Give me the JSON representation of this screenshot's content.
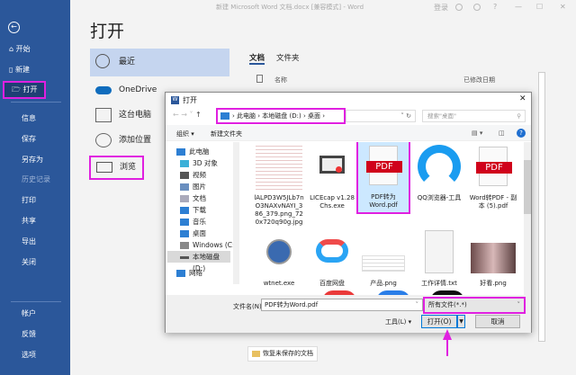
{
  "window": {
    "title": "新建 Microsoft Word 文档.docx [兼容模式] - Word",
    "login": "登录",
    "help": "?",
    "minimize": "—",
    "maximize": "☐",
    "close": "✕"
  },
  "sidebar": {
    "items": [
      {
        "label": "开始"
      },
      {
        "label": "新建"
      },
      {
        "label": "打开"
      },
      {
        "label": "信息"
      },
      {
        "label": "保存"
      },
      {
        "label": "另存为"
      },
      {
        "label": "历史记录"
      },
      {
        "label": "打印"
      },
      {
        "label": "共享"
      },
      {
        "label": "导出"
      },
      {
        "label": "关闭"
      },
      {
        "label": "帐户"
      },
      {
        "label": "反馈"
      },
      {
        "label": "选项"
      }
    ]
  },
  "main": {
    "title": "打开",
    "locations": [
      {
        "label": "最近"
      },
      {
        "label": "OneDrive"
      },
      {
        "label": "这台电脑"
      },
      {
        "label": "添加位置"
      },
      {
        "label": "浏览"
      }
    ],
    "tabs": [
      {
        "label": "文档"
      },
      {
        "label": "文件夹"
      }
    ],
    "columns": {
      "name": "名称",
      "modified": "已修改日期"
    },
    "recover": "恢复未保存的文档"
  },
  "dialog": {
    "title": "打开",
    "breadcrumb": [
      "此电脑",
      "本地磁盘 (D:)",
      "桌面"
    ],
    "search_placeholder": "搜索\"桌面\"",
    "organize": "组织 ▾",
    "new_folder": "新建文件夹",
    "nav": [
      {
        "label": "此电脑"
      },
      {
        "label": "3D 对象"
      },
      {
        "label": "视频"
      },
      {
        "label": "图片"
      },
      {
        "label": "文档"
      },
      {
        "label": "下载"
      },
      {
        "label": "音乐"
      },
      {
        "label": "桌面"
      },
      {
        "label": "Windows (C:)"
      },
      {
        "label": "本地磁盘 (D:)"
      },
      {
        "label": "网络"
      }
    ],
    "files": [
      {
        "name": "lALPD3W5JLb7nO3NAXvNAYI_386_379.png_720x720q90g.jpg"
      },
      {
        "name": "LICEcap v1.28 Chs.exe"
      },
      {
        "name": "PDF转为Word.pdf"
      },
      {
        "name": "QQ浏览器-工具"
      },
      {
        "name": "Word转PDF - 副本 (5).pdf"
      },
      {
        "name": "wtnet.exe"
      },
      {
        "name": "百度网盘"
      },
      {
        "name": "产品.png"
      },
      {
        "name": "工作详情.txt"
      },
      {
        "name": "好看.png"
      }
    ],
    "filename_label": "文件名(N):",
    "filename_value": "PDF转为Word.pdf",
    "filetype": "所有文件(*.*)",
    "tools": "工具(L)",
    "open": "打开(O)",
    "cancel": "取消",
    "pdf_badge": "PDF"
  },
  "colors": {
    "sidebar": "#2b579a",
    "highlight": "#e020e0",
    "selected": "#cce8ff"
  }
}
